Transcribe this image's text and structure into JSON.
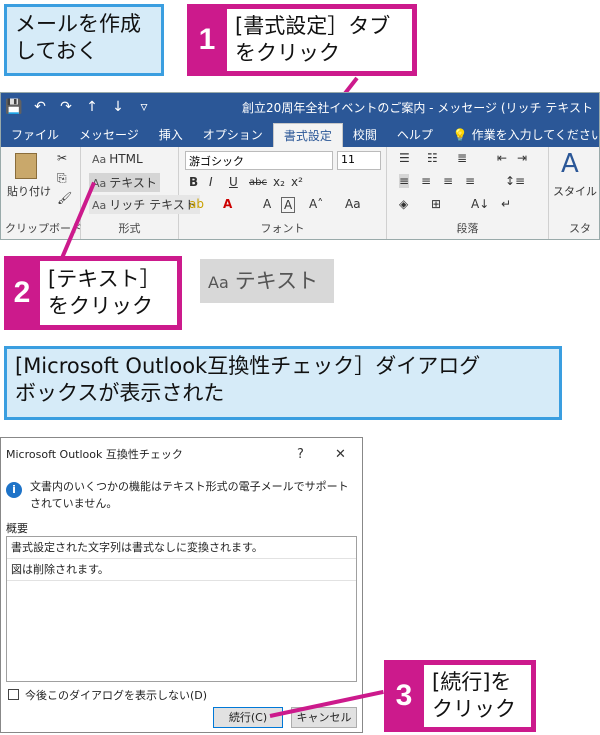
{
  "callouts": {
    "create_mail": [
      "メールを作成",
      "しておく"
    ],
    "dialog_shown": [
      "[Microsoft Outlook互換性チェック］ダイアログ",
      "ボックスが表示された"
    ]
  },
  "steps": [
    {
      "num": "1",
      "lines": [
        "[書式設定］タブ",
        "をクリック"
      ]
    },
    {
      "num": "2",
      "lines": [
        "[テキスト］",
        "をクリック"
      ]
    },
    {
      "num": "3",
      "lines": [
        "[続行]を",
        "クリック"
      ]
    }
  ],
  "zoom_label": {
    "aa": "Aa",
    "text": "テキスト"
  },
  "ribbon": {
    "window_title": "創立20周年全社イベントのご案内 - メッセージ (リッチ テキスト",
    "quick_icons": [
      "💾",
      "↶",
      "↷",
      "↑",
      "↓",
      "▿"
    ],
    "tabs": [
      "ファイル",
      "メッセージ",
      "挿入",
      "オプション",
      "書式設定",
      "校閲",
      "ヘルプ",
      "💡 作業を入力してください"
    ],
    "active_tab": "書式設定",
    "clipboard": {
      "paste": "貼り付け",
      "label": "クリップボード"
    },
    "format": {
      "label": "形式",
      "items": [
        {
          "aa": "Aa",
          "text": "HTML"
        },
        {
          "aa": "Aa",
          "text": "テキスト"
        },
        {
          "aa": "Aa",
          "text": "リッチ テキスト"
        }
      ]
    },
    "font": {
      "name": "游ゴシック",
      "size": "11",
      "label": "フォント"
    },
    "paragraph": {
      "label": "段落"
    },
    "style": {
      "btn": "スタイル",
      "label": "スタ"
    }
  },
  "dialog": {
    "title": "Microsoft Outlook 互換性チェック",
    "help": "?",
    "close": "✕",
    "info_icon": "i",
    "message": "文書内のいくつかの機能はテキスト形式の電子メールでサポートされていません。",
    "summary_label": "概要",
    "rows": [
      "書式設定された文字列は書式なしに変換されます。",
      "図は削除されます。"
    ],
    "checkbox_label": "今後このダイアログを表示しない(D)",
    "continue_btn": "続行(C)",
    "cancel_btn": "キャンセル"
  }
}
